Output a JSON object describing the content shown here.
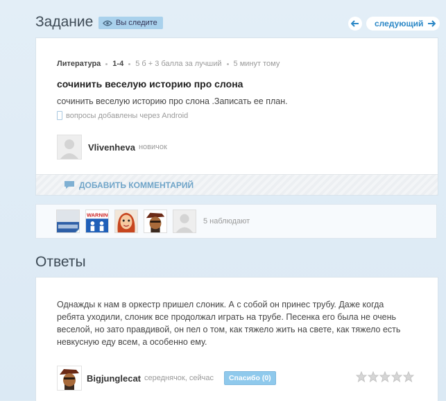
{
  "question_section": {
    "title": "Задание",
    "follow_badge": "Вы следите",
    "prev_icon": "arrow-left-icon",
    "next_label": "следующий",
    "next_icon": "arrow-right-icon"
  },
  "question": {
    "subject": "Литература",
    "grade": "1-4",
    "points": "5 б + 3 балла за лучший",
    "time": "5 минут тому",
    "title": "сочинить веселую историю про слона",
    "text": "сочинить веселую историю про слона .Записать ее план.",
    "device_note": "вопросы добавлены через Android",
    "author": {
      "name": "Vlivenheva",
      "rank": "новичок"
    },
    "comment_label": "ДОБАВИТЬ КОММЕНТАРИЙ"
  },
  "watchers": {
    "count_label": "5 наблюдают",
    "avatars": [
      "photo-avatar",
      "warning-avatar",
      "cartoon-girl-avatar",
      "cartoon-man-avatar",
      "default-avatar"
    ]
  },
  "answers_section": {
    "title": "Ответы"
  },
  "answer": {
    "text": "Однажды к нам в оркестр пришел слоник. А с собой он принес трубу. Даже когда ребята уходили, слоник все продолжал играть на трубе. Песенка его была не очень веселой, но зато правдивой, он пел о том, как тяжело жить на свете, как тяжело есть невкусную еду всем, а особенно ему.",
    "author": "Bigjunglecat",
    "meta": "середнячок, сейчас",
    "thanks_label": "Спасибо (0)",
    "rating": 0,
    "max_rating": 5
  },
  "colors": {
    "accent": "#2b87c6",
    "badge": "#a9d1ec",
    "thanks": "#8fc9ec"
  }
}
